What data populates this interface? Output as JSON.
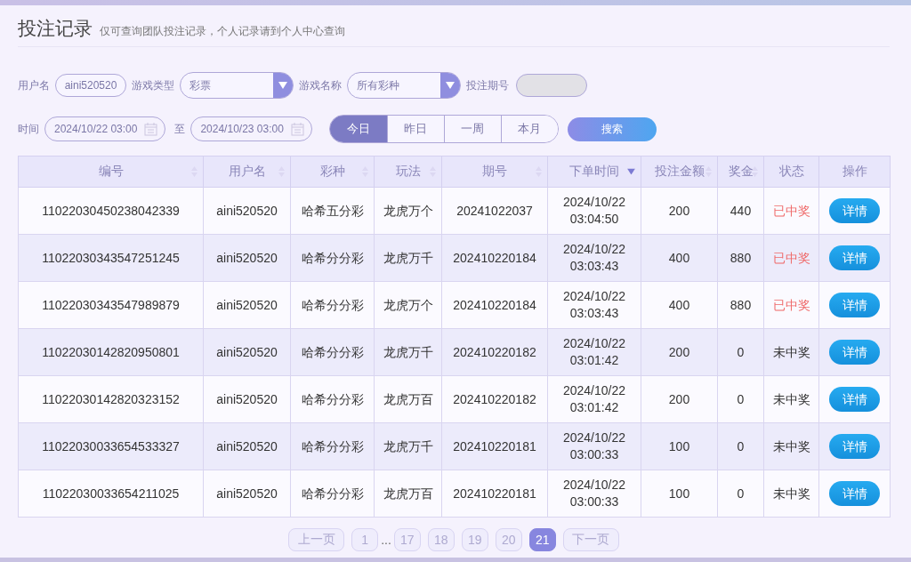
{
  "header": {
    "title": "投注记录",
    "note": "仅可查询团队投注记录，个人记录请到个人中心查询"
  },
  "filters": {
    "username": {
      "label": "用户名",
      "value": "aini520520"
    },
    "game_type": {
      "label": "游戏类型",
      "value": "彩票"
    },
    "game_name": {
      "label": "游戏名称",
      "value": "所有彩种"
    },
    "issue": {
      "label": "投注期号"
    },
    "time": {
      "label": "时间",
      "from": "2024/10/22 03:00",
      "to_label": "至",
      "to": "2024/10/23 03:00"
    },
    "periods": [
      {
        "label": "今日",
        "selected": true
      },
      {
        "label": "昨日",
        "selected": false
      },
      {
        "label": "一周",
        "selected": false
      },
      {
        "label": "本月",
        "selected": false
      }
    ],
    "search_button": "搜索"
  },
  "table": {
    "columns": [
      {
        "label": "编号",
        "sortable": true,
        "sorted_desc": false
      },
      {
        "label": "用户名",
        "sortable": true,
        "sorted_desc": false
      },
      {
        "label": "彩种",
        "sortable": true,
        "sorted_desc": false
      },
      {
        "label": "玩法",
        "sortable": true,
        "sorted_desc": false
      },
      {
        "label": "期号",
        "sortable": true,
        "sorted_desc": false
      },
      {
        "label": "下单时间",
        "sorted_desc": true
      },
      {
        "label": "投注金额",
        "sortable": true,
        "sorted_desc": false
      },
      {
        "label": "奖金",
        "sortable": true,
        "sorted_desc": false
      },
      {
        "label": "状态",
        "sortable": false
      },
      {
        "label": "操作",
        "sortable": false
      }
    ],
    "rows": [
      {
        "id": "11022030450238042339",
        "user": "aini520520",
        "lottery": "哈希五分彩",
        "play": "龙虎万个",
        "issue": "20241022037",
        "date": "2024/10/22",
        "time": "03:04:50",
        "amount": "200",
        "prize": "440",
        "status": "已中奖",
        "won": true,
        "action": "详情"
      },
      {
        "id": "11022030343547251245",
        "user": "aini520520",
        "lottery": "哈希分分彩",
        "play": "龙虎万千",
        "issue": "202410220184",
        "date": "2024/10/22",
        "time": "03:03:43",
        "amount": "400",
        "prize": "880",
        "status": "已中奖",
        "won": true,
        "action": "详情"
      },
      {
        "id": "11022030343547989879",
        "user": "aini520520",
        "lottery": "哈希分分彩",
        "play": "龙虎万个",
        "issue": "202410220184",
        "date": "2024/10/22",
        "time": "03:03:43",
        "amount": "400",
        "prize": "880",
        "status": "已中奖",
        "won": true,
        "action": "详情"
      },
      {
        "id": "11022030142820950801",
        "user": "aini520520",
        "lottery": "哈希分分彩",
        "play": "龙虎万千",
        "issue": "202410220182",
        "date": "2024/10/22",
        "time": "03:01:42",
        "amount": "200",
        "prize": "0",
        "status": "未中奖",
        "won": false,
        "action": "详情"
      },
      {
        "id": "11022030142820323152",
        "user": "aini520520",
        "lottery": "哈希分分彩",
        "play": "龙虎万百",
        "issue": "202410220182",
        "date": "2024/10/22",
        "time": "03:01:42",
        "amount": "200",
        "prize": "0",
        "status": "未中奖",
        "won": false,
        "action": "详情"
      },
      {
        "id": "11022030033654533327",
        "user": "aini520520",
        "lottery": "哈希分分彩",
        "play": "龙虎万千",
        "issue": "202410220181",
        "date": "2024/10/22",
        "time": "03:00:33",
        "amount": "100",
        "prize": "0",
        "status": "未中奖",
        "won": false,
        "action": "详情"
      },
      {
        "id": "11022030033654211025",
        "user": "aini520520",
        "lottery": "哈希分分彩",
        "play": "龙虎万百",
        "issue": "202410220181",
        "date": "2024/10/22",
        "time": "03:00:33",
        "amount": "100",
        "prize": "0",
        "status": "未中奖",
        "won": false,
        "action": "详情"
      }
    ]
  },
  "pagination": [
    {
      "kind": "prev",
      "label": "上一页"
    },
    {
      "kind": "page",
      "label": "1",
      "selected": false
    },
    {
      "kind": "ellipsis",
      "label": "..."
    },
    {
      "kind": "page",
      "label": "17",
      "selected": false
    },
    {
      "kind": "page",
      "label": "18",
      "selected": false
    },
    {
      "kind": "page",
      "label": "19",
      "selected": false
    },
    {
      "kind": "page",
      "label": "20",
      "selected": false
    },
    {
      "kind": "page",
      "label": "21",
      "selected": true
    },
    {
      "kind": "next",
      "label": "下一页"
    }
  ]
}
